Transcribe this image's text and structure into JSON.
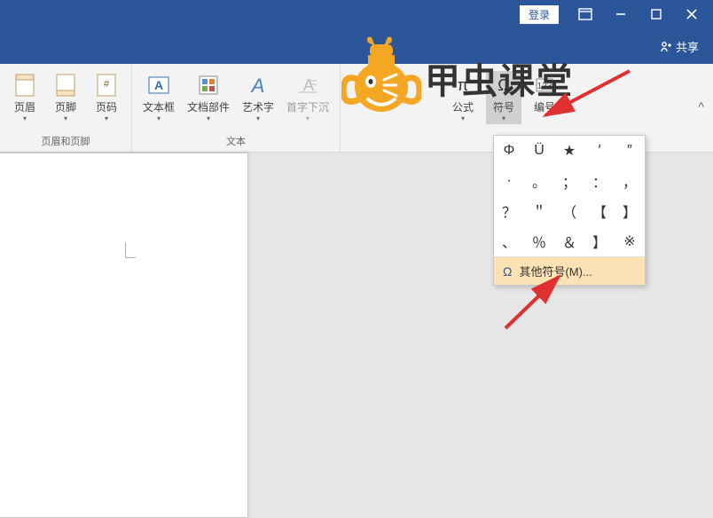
{
  "titlebar": {
    "login": "登录"
  },
  "sharebar": {
    "share": "共享"
  },
  "ribbon": {
    "group1": {
      "label": "页眉和页脚",
      "items": [
        {
          "label": "页眉"
        },
        {
          "label": "页脚"
        },
        {
          "label": "页码"
        }
      ]
    },
    "group2": {
      "label": "文本",
      "items": [
        {
          "label": "文本框"
        },
        {
          "label": "文档部件"
        },
        {
          "label": "艺术字"
        },
        {
          "label": "首字下沉"
        }
      ]
    },
    "group3": {
      "items": [
        {
          "label": "公式"
        },
        {
          "label": "符号"
        },
        {
          "label": "编号"
        }
      ]
    }
  },
  "symbol_dropdown": {
    "grid": [
      "Φ",
      "Ü",
      "★",
      "′",
      "″",
      "·",
      "。",
      "；",
      "：",
      "，",
      "？",
      "＂",
      "（",
      "【",
      "】",
      "、",
      "％",
      "＆",
      "】",
      "※"
    ],
    "more": "其他符号(M)..."
  },
  "watermark": {
    "text": "甲虫课堂"
  }
}
